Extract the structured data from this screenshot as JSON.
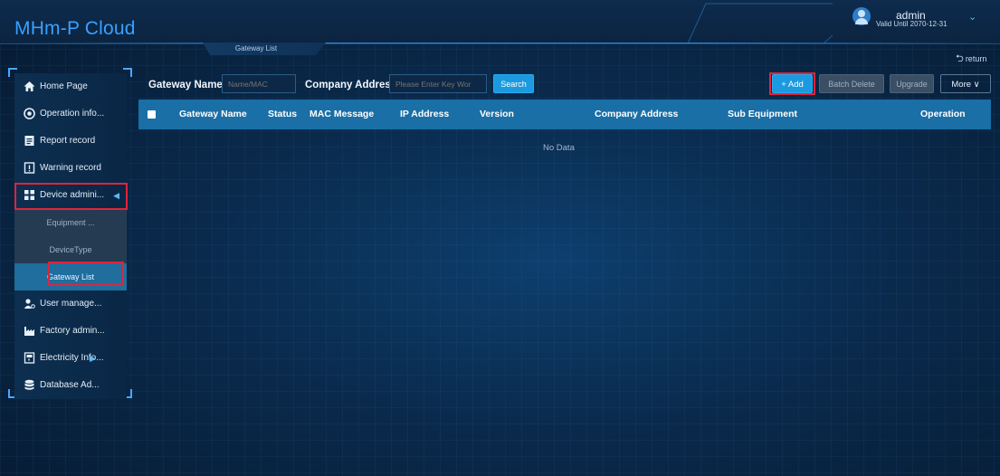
{
  "header": {
    "app_title": "MHm-P Cloud",
    "user": {
      "name": "admin",
      "valid_until": "Valid Until 2070-12-31"
    },
    "chevron": "⌄"
  },
  "tabs": [
    {
      "label": "Gateway List"
    }
  ],
  "return_label": "return",
  "sidebar": {
    "items": [
      {
        "label": "Home Page",
        "icon": "home-icon"
      },
      {
        "label": "Operation info...",
        "icon": "operation-icon"
      },
      {
        "label": "Report record",
        "icon": "report-icon"
      },
      {
        "label": "Warning record",
        "icon": "warning-icon"
      },
      {
        "label": "Device admini...",
        "icon": "device-icon",
        "expanded": true
      },
      {
        "label": "User manage...",
        "icon": "user-icon"
      },
      {
        "label": "Factory admin...",
        "icon": "factory-icon"
      },
      {
        "label": "Electricity Info...",
        "icon": "electricity-icon",
        "has_submenu": true
      },
      {
        "label": "Database Ad...",
        "icon": "database-icon"
      }
    ],
    "submenu": [
      {
        "label": "Equipment ..."
      },
      {
        "label": "DeviceType"
      },
      {
        "label": "Gateway List",
        "active": true
      }
    ]
  },
  "filters": {
    "gateway_name_label": "Gateway Name",
    "gateway_name_placeholder": "Name/MAC",
    "gateway_name_value": "",
    "company_address_label": "Company Address",
    "company_address_placeholder": "Please Enter Key Wor",
    "company_address_value": "",
    "search_label": "Search"
  },
  "toolbar": {
    "add_label": "+ Add",
    "batch_delete_label": "Batch Delete",
    "upgrade_label": "Upgrade",
    "more_label": "More ∨"
  },
  "table": {
    "columns": [
      "Gateway Name",
      "Status",
      "MAC Message",
      "IP Address",
      "Version",
      "Company Address",
      "Sub Equipment",
      "Operation"
    ],
    "rows": [],
    "empty_text": "No Data"
  },
  "colors": {
    "accent": "#1b9adf",
    "header_row": "#1a6fa6",
    "highlight_box": "#e0243b",
    "logo": "#3aa0ff"
  }
}
